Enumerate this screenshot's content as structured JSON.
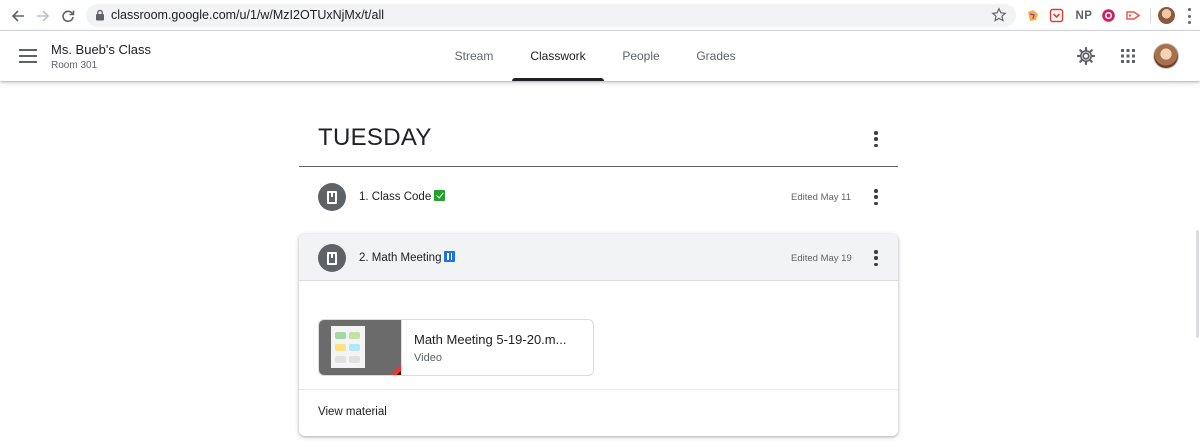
{
  "browser": {
    "url": "classroom.google.com/u/1/w/MzI2OTUxNjMx/t/all",
    "extensions": [
      "puzzle-extension-icon",
      "pocket-extension-icon",
      "NP",
      "record-extension-icon",
      "cast-extension-icon"
    ],
    "np_label": "NP"
  },
  "header": {
    "class_name": "Ms. Bueb's Class",
    "room": "Room 301",
    "tabs": [
      {
        "label": "Stream",
        "active": false
      },
      {
        "label": "Classwork",
        "active": true
      },
      {
        "label": "People",
        "active": false
      },
      {
        "label": "Grades",
        "active": false
      }
    ]
  },
  "topic": {
    "title": "TUESDAY",
    "items": [
      {
        "title": "1. Class Code",
        "emoji": "check-mark-icon",
        "meta": "Edited May 11"
      },
      {
        "title": "2. Math Meeting",
        "emoji": "abacus-icon",
        "meta": "Edited May 19",
        "expanded": true
      }
    ]
  },
  "expanded_card": {
    "attachment_title": "Math Meeting 5-19-20.m...",
    "attachment_type": "Video",
    "view_material_label": "View material"
  },
  "colors": {
    "accent": "#202124",
    "header_bg": "#f1f3f4",
    "icon_gray": "#5f6368",
    "check_green": "#21a32a",
    "abacus_blue": "#1a73e8"
  }
}
